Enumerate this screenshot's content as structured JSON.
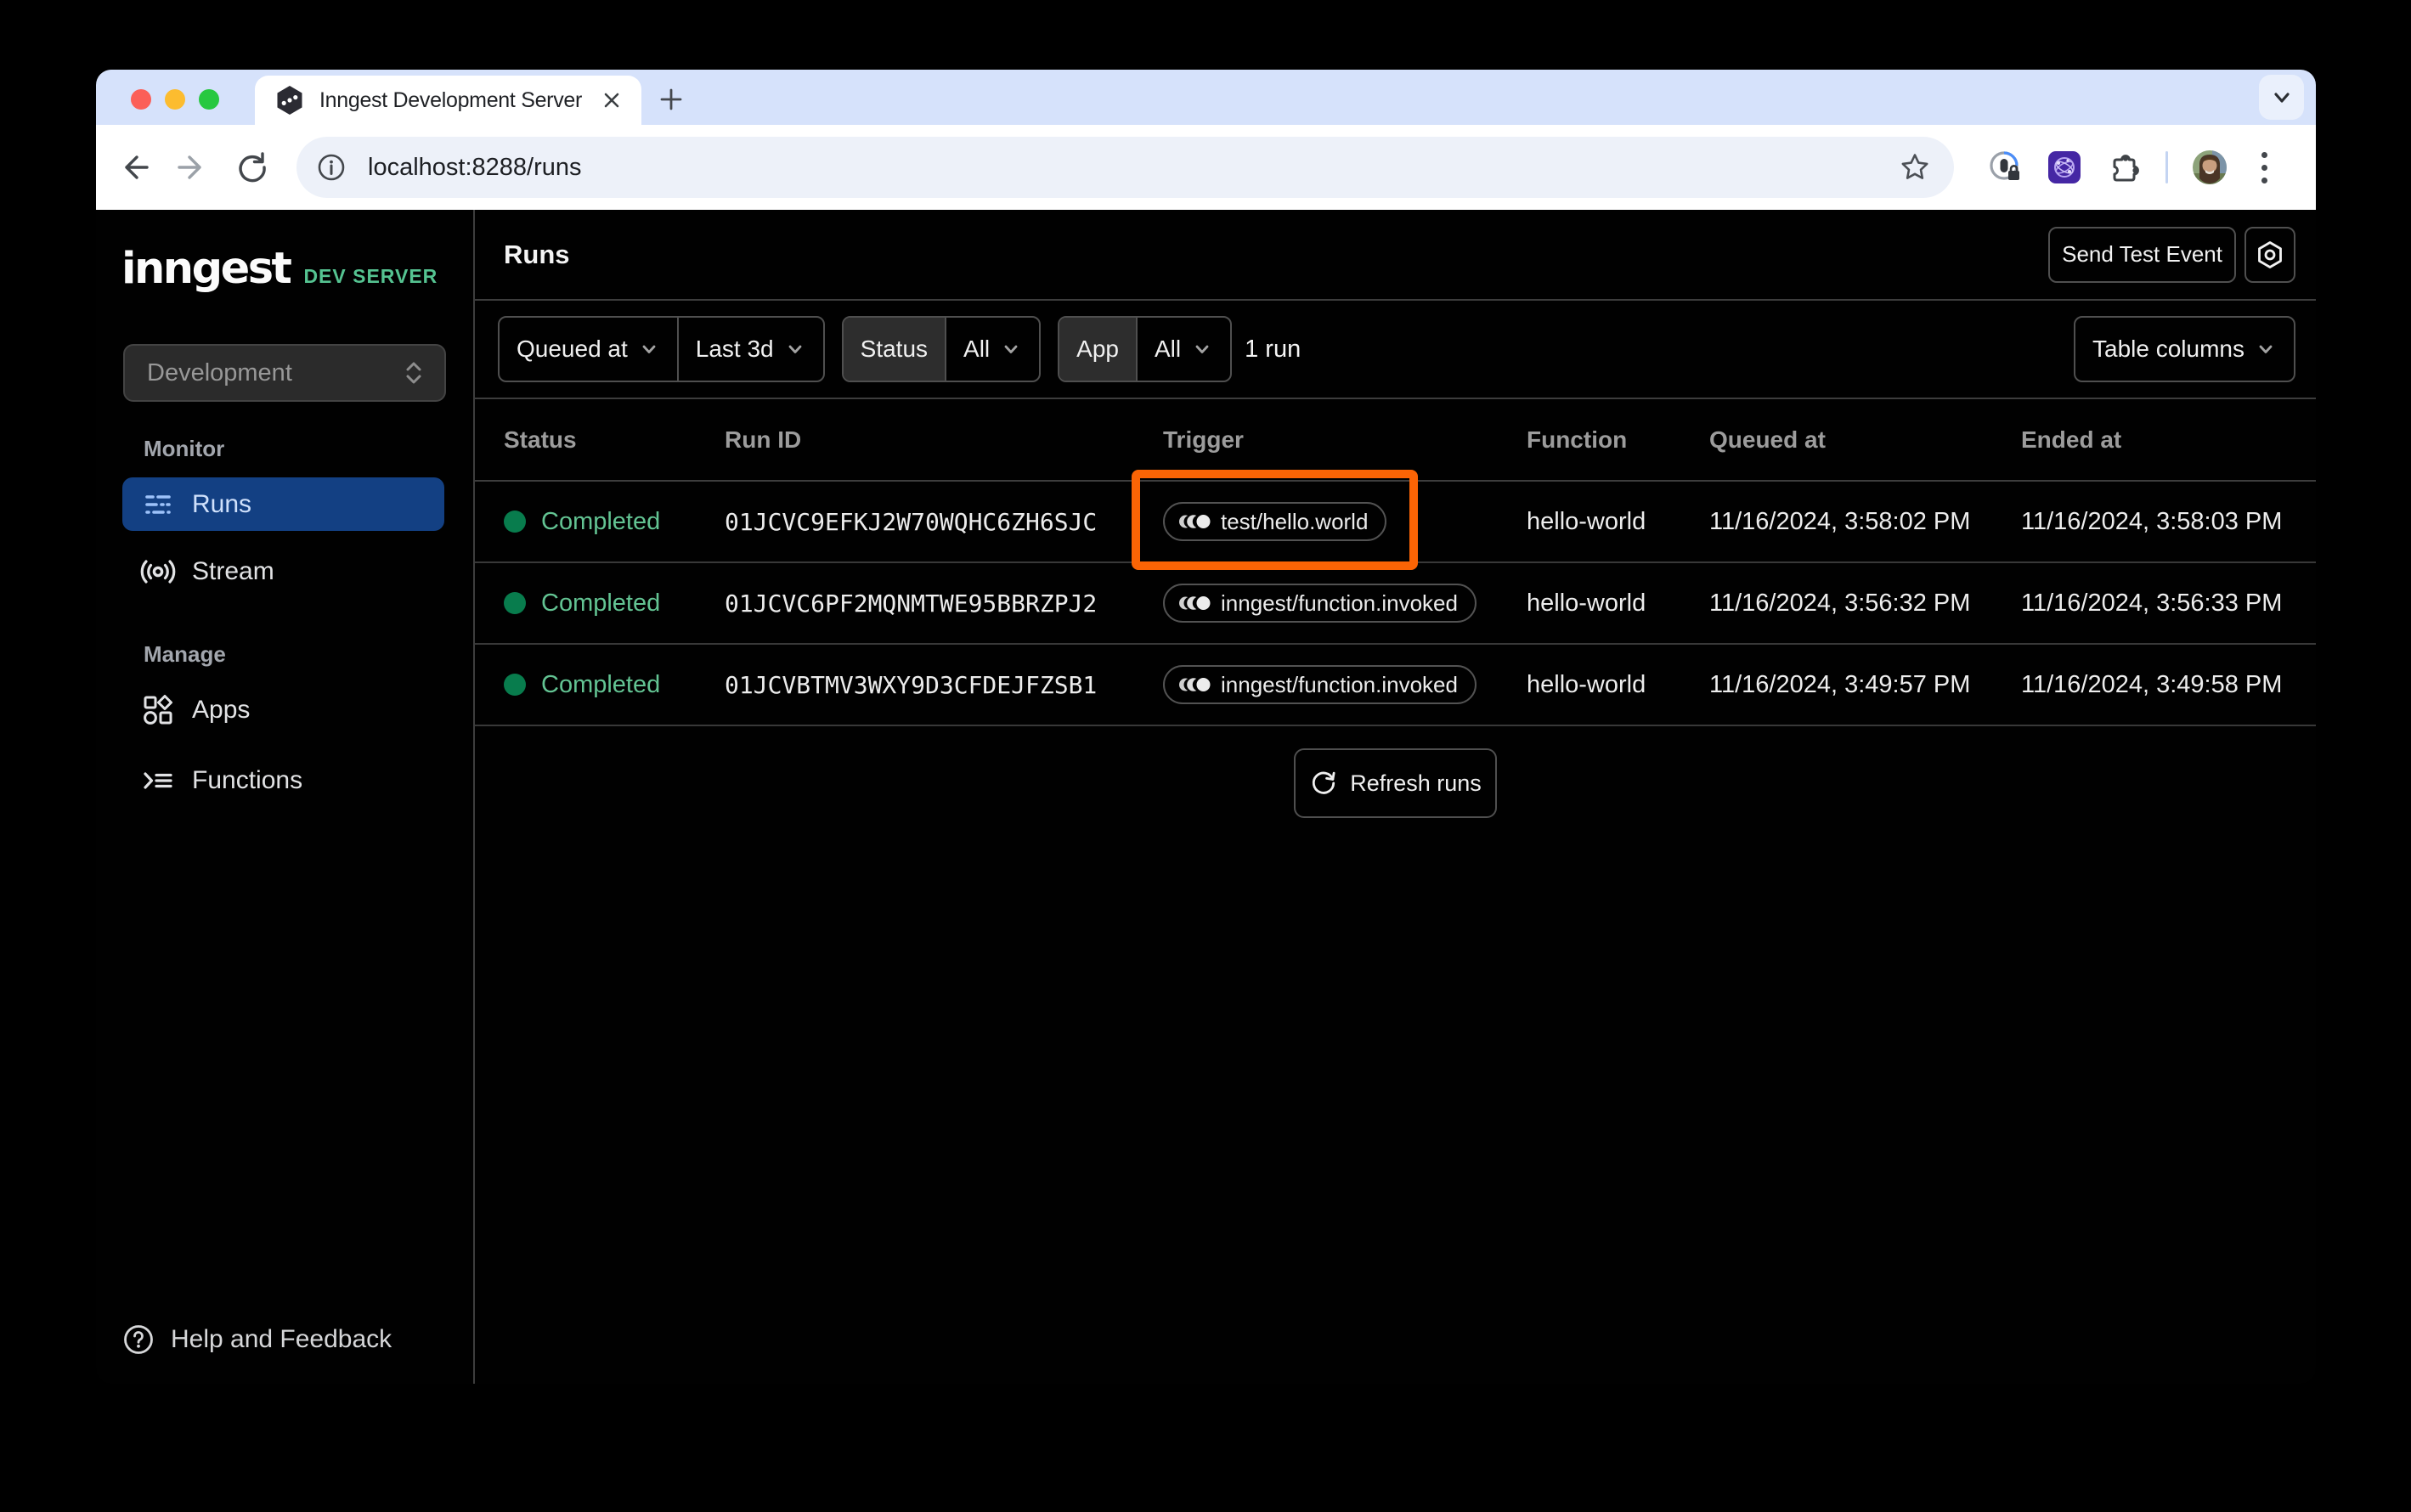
{
  "browser": {
    "tab_title": "Inngest Development Server",
    "url": "localhost:8288/runs"
  },
  "sidebar": {
    "logo": "inngest",
    "badge": "DEV SERVER",
    "environment": "Development",
    "sections": [
      {
        "label": "Monitor",
        "items": [
          {
            "label": "Runs"
          },
          {
            "label": "Stream"
          }
        ]
      },
      {
        "label": "Manage",
        "items": [
          {
            "label": "Apps"
          },
          {
            "label": "Functions"
          }
        ]
      }
    ],
    "help": "Help and Feedback"
  },
  "header": {
    "title": "Runs",
    "send_test_event": "Send Test Event"
  },
  "filters": {
    "queued_at_label": "Queued at",
    "time_range": "Last 3d",
    "status_label": "Status",
    "status_value": "All",
    "app_label": "App",
    "app_value": "All",
    "result_count": "1 run",
    "table_columns_label": "Table columns"
  },
  "table": {
    "columns": [
      "Status",
      "Run ID",
      "Trigger",
      "Function",
      "Queued at",
      "Ended at"
    ],
    "rows": [
      {
        "status": "Completed",
        "run_id": "01JCVC9EFKJ2W70WQHC6ZH6SJC",
        "trigger": "test/hello.world",
        "function": "hello-world",
        "queued_at": "11/16/2024, 3:58:02 PM",
        "ended_at": "11/16/2024, 3:58:03 PM"
      },
      {
        "status": "Completed",
        "run_id": "01JCVC6PF2MQNMTWE95BBRZPJ2",
        "trigger": "inngest/function.invoked",
        "function": "hello-world",
        "queued_at": "11/16/2024, 3:56:32 PM",
        "ended_at": "11/16/2024, 3:56:33 PM"
      },
      {
        "status": "Completed",
        "run_id": "01JCVBTMV3WXY9D3CFDEJFZSB1",
        "trigger": "inngest/function.invoked",
        "function": "hello-world",
        "queued_at": "11/16/2024, 3:49:57 PM",
        "ended_at": "11/16/2024, 3:49:58 PM"
      }
    ]
  },
  "refresh_label": "Refresh runs",
  "colors": {
    "annotation_orange": "#fb6405",
    "active_nav_blue": "#134083",
    "status_green": "#63c493",
    "tabstrip_blue": "#d6e2fb"
  }
}
